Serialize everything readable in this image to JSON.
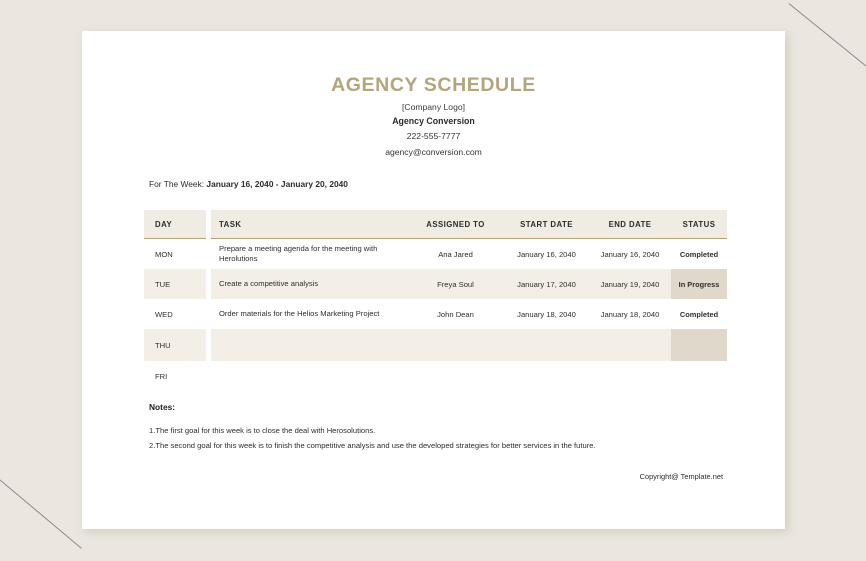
{
  "document": {
    "title": "AGENCY SCHEDULE",
    "company_logo_placeholder": "[Company Logo]",
    "company_name": "Agency Conversion",
    "phone": "222-555-7777",
    "email": "agency@conversion.com",
    "week_label": "For The Week:",
    "week_value": "January 16, 2040 - January 20, 2040",
    "copyright": "Copyright@ Template.net"
  },
  "colors": {
    "title": "#b3a57c",
    "header_rule": "#b5a578",
    "header_bg": "#f1ece3",
    "row_tint": "#f4efe6",
    "status_highlight": "#e0d8ca",
    "page_bg": "#ffffff",
    "canvas_bg": "#ebe6df"
  },
  "table": {
    "headers": {
      "day": "DAY",
      "task": "TASK",
      "assigned_to": "ASSIGNED TO",
      "start_date": "START DATE",
      "end_date": "END DATE",
      "status": "STATUS"
    },
    "rows": [
      {
        "day": "MON",
        "task": "Prepare a meeting agenda for the meeting with Herolutions",
        "assigned_to": "Ana Jared",
        "start_date": "January 16, 2040",
        "end_date": "January 16, 2040",
        "status": "Completed"
      },
      {
        "day": "TUE",
        "task": "Create a competitive analysis",
        "assigned_to": "Freya Soul",
        "start_date": "January 17, 2040",
        "end_date": "January 19, 2040",
        "status": "In Progress"
      },
      {
        "day": "WED",
        "task": "Order materials for the Helios Marketing Project",
        "assigned_to": "John Dean",
        "start_date": "January 18, 2040",
        "end_date": "January 18, 2040",
        "status": "Completed"
      },
      {
        "day": "THU",
        "task": "",
        "assigned_to": "",
        "start_date": "",
        "end_date": "",
        "status": ""
      },
      {
        "day": "FRI",
        "task": "",
        "assigned_to": "",
        "start_date": "",
        "end_date": "",
        "status": ""
      }
    ]
  },
  "notes": {
    "title": "Notes:",
    "items": [
      "1.The first goal for this week is to close the deal with Herosolutions.",
      "2.The second goal for this week is to finish the competitive analysis and use the developed strategies for better services in the future."
    ]
  }
}
